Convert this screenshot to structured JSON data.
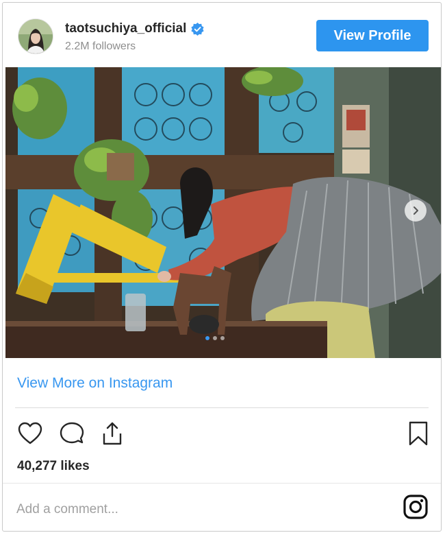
{
  "header": {
    "username": "taotsuchiya_official",
    "followers": "2.2M followers",
    "view_profile_label": "View Profile",
    "verified_icon": "verified-badge-icon"
  },
  "post": {
    "image_alt": "taotsuchiya_official post photo",
    "carousel_dots": 3,
    "active_dot": 1
  },
  "links": {
    "view_more": "View More on Instagram"
  },
  "actions": {
    "icons": [
      "heart-icon",
      "comment-icon",
      "share-icon",
      "bookmark-icon"
    ]
  },
  "likes": "40,277 likes",
  "comment": {
    "placeholder": "Add a comment..."
  },
  "colors": {
    "accent": "#3897f0",
    "button": "#2d95ef",
    "muted": "#8e8e8e",
    "text": "#262626"
  }
}
